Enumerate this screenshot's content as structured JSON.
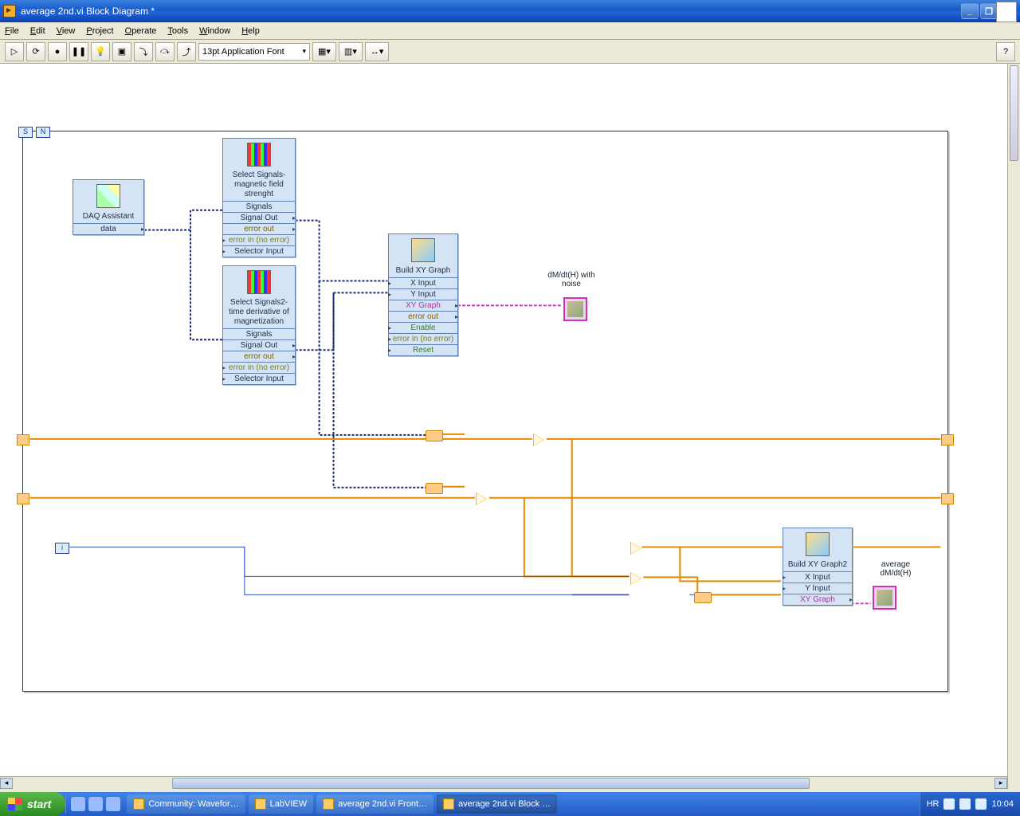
{
  "window": {
    "title": "average 2nd.vi Block Diagram *"
  },
  "menu": {
    "file": "File",
    "edit": "Edit",
    "view": "View",
    "project": "Project",
    "operate": "Operate",
    "tools": "Tools",
    "window": "Window",
    "help": "Help"
  },
  "toolbar": {
    "font": "13pt Application Font"
  },
  "loop": {
    "s": "S",
    "n": "N",
    "i": "i"
  },
  "nodes": {
    "daq": {
      "name": "DAQ Assistant",
      "rows": [
        "data"
      ]
    },
    "sel1": {
      "name": "Select Signals-magnetic field strenght",
      "rows": [
        "Signals",
        "Signal Out",
        "error out",
        "error in (no error)",
        "Selector Input"
      ]
    },
    "sel2": {
      "name": "Select Signals2-time derivative of magnetization",
      "rows": [
        "Signals",
        "Signal Out",
        "error out",
        "error in (no error)",
        "Selector Input"
      ]
    },
    "build1": {
      "name": "Build XY Graph",
      "rows": [
        "X Input",
        "Y Input",
        "XY Graph",
        "error out",
        "Enable",
        "error in (no error)",
        "Reset"
      ]
    },
    "build2": {
      "name": "Build XY Graph2",
      "rows": [
        "X Input",
        "Y Input",
        "XY Graph"
      ]
    }
  },
  "graphs": {
    "g1": "dM/dt(H) with noise",
    "g2": "average dM/dt(H)"
  },
  "tasks": {
    "t1": "Community: Wavefor…",
    "t2": "LabVIEW",
    "t3": "average 2nd.vi Front…",
    "t4": "average 2nd.vi Block …"
  },
  "tray": {
    "lang": "HR",
    "time": "10:04"
  },
  "start": "start"
}
